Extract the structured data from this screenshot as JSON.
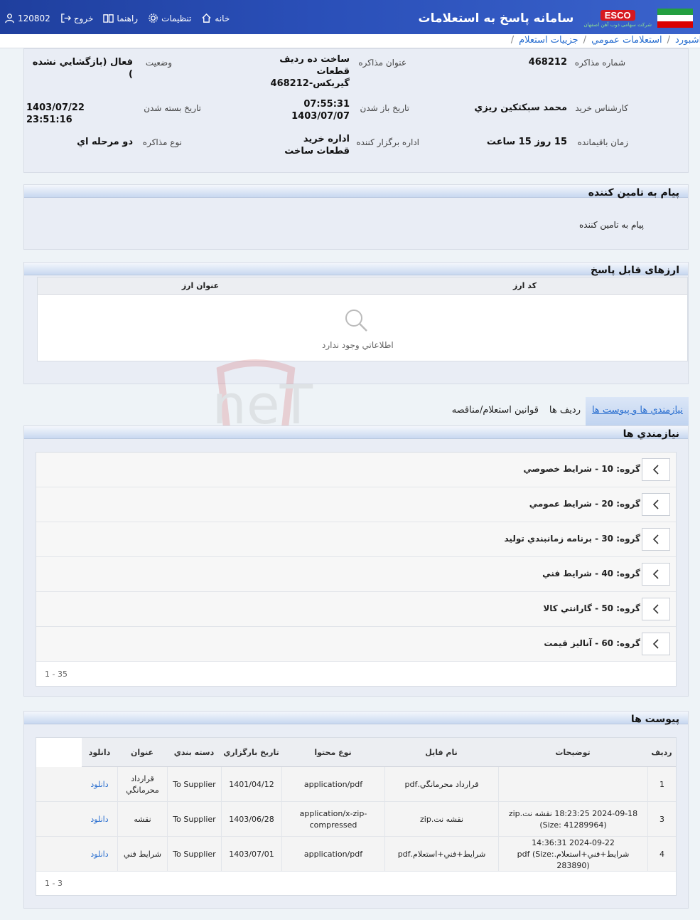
{
  "header": {
    "app_title": "سامانه پاسخ به استعلامات",
    "brand": "ESCO",
    "brand_sub": "شرکت سهامی ذوب آهن اصفهان",
    "menu": {
      "home": "خانه",
      "settings": "تنظیمات",
      "help": "راهنما",
      "logout": "خروج",
      "user": "120802"
    }
  },
  "breadcrumb": {
    "items": [
      "داشبورد",
      "استعلامات عمومي",
      "جزييات استعلام"
    ],
    "separator": "/"
  },
  "info": {
    "negotiation_number_label": "شماره مذاکره",
    "negotiation_number": "468212",
    "title_label": "عنوان مذاکره",
    "title": "ساخت ده رديف قطعات گيربکس-468212",
    "status_label": "وضعيت",
    "status": "فعال (بازگشايي نشده )",
    "expert_label": "کارشناس خريد",
    "expert": "محمد سبکتکين ريزي",
    "open_date_label": "تاريخ باز شدن",
    "open_date": "07:55:31 1403/07/07",
    "close_date_label": "تاريخ بسته شدن",
    "close_date": "1403/07/22 23:51:16",
    "remaining_label": "زمان باقيمانده",
    "remaining": "15 روز 15 ساعت",
    "organizer_label": "اداره برگزار کننده",
    "organizer": "اداره خريد قطعات ساخت",
    "type_label": "نوع مذاکره",
    "type": "دو مرحله اي"
  },
  "supplier_message": {
    "title": "پيام به تامين کننده",
    "body": "پيام به تامين کننده"
  },
  "currencies": {
    "title": "ارزهای قابل پاسخ",
    "columns": [
      "کد ارز",
      "عنوان ارز"
    ],
    "empty_text": "اطلاعاتي وجود ندارد"
  },
  "tabs": {
    "items": [
      "نيازمندي ها و پيوست ها",
      "رديف ها",
      "قوانين استعلام/مناقصه"
    ],
    "active": 0
  },
  "needs": {
    "title": "نيازمندي ها",
    "groups": [
      "گروه: 10 - شرايط خصوصي",
      "گروه: 20 - شرايط عمومي",
      "گروه: 30 - برنامه زمانبندي توليد",
      "گروه: 40 - شرايط فني",
      "گروه: 50 - گارانتي کالا",
      "گروه: 60 - آناليز قيمت"
    ],
    "pager": "1 - 35"
  },
  "attachments": {
    "title": "پيوست ها",
    "columns": [
      "رديف",
      "توضيحات",
      "نام فايل",
      "نوع محتوا",
      "تاريخ بارگزاري",
      "دسته بندي",
      "عنوان",
      "دانلود"
    ],
    "rows": [
      {
        "row": "1",
        "desc": "",
        "file": "قرارداد محرمانگي.pdf",
        "type": "application/pdf",
        "date": "1401/04/12",
        "category": "To Supplier",
        "title": "قرارداد محرمانگي",
        "download": "دانلود"
      },
      {
        "row": "3",
        "desc": "2024-09-18 18:23:25 نقشه نت.zip (Size: 41289964)",
        "file": "نقشه نت.zip",
        "type": "application/x-zip-compressed",
        "date": "1403/06/28",
        "category": "To Supplier",
        "title": "نقشه",
        "download": "دانلود"
      },
      {
        "row": "4",
        "desc": "2024-09-22 14:36:31 شرايط+فني+استعلام.pdf (Size: 283890)",
        "file": "شرايط+فني+استعلام.pdf",
        "type": "application/pdf",
        "date": "1403/07/01",
        "category": "To Supplier",
        "title": "شرايط فني",
        "download": "دانلود"
      }
    ],
    "pager": "1 - 3"
  },
  "watermark": "AriaTender.neT",
  "colors": {
    "header_bg": "#2a4fb8",
    "link": "#2a6fd0",
    "panel_bg": "#e9edf5",
    "brand_red": "#d71920"
  }
}
